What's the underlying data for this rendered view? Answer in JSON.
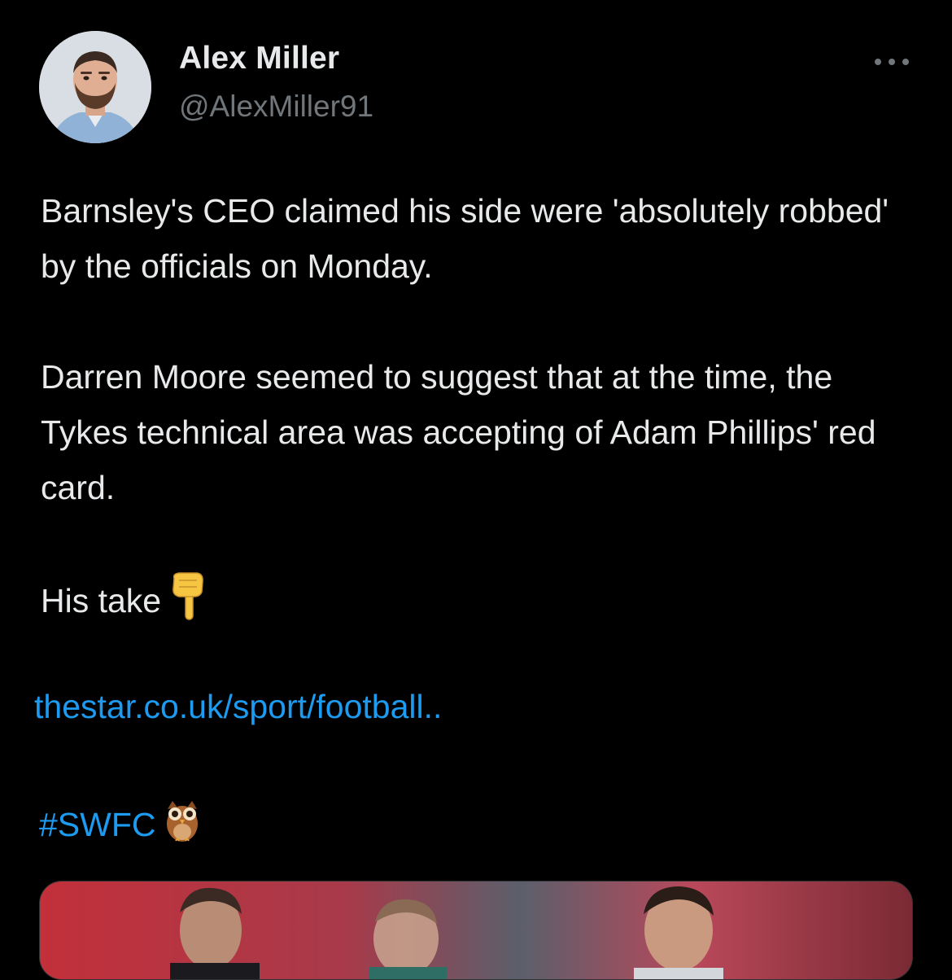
{
  "tweet": {
    "author": {
      "display_name": "Alex Miller",
      "handle": "@AlexMiller91",
      "avatar_icon": "profile-photo"
    },
    "more_icon": "more-horizontal-icon",
    "paragraphs": [
      "Barnsley's CEO claimed his side were 'absolutely robbed' by the officials on Monday.",
      "Darren Moore seemed to suggest that at the time, the Tykes technical area was accepting of Adam Phillips' red card."
    ],
    "take_text": "His take",
    "take_emoji": "pointing-down-emoji",
    "link_text": "thestar.co.uk/sport/football..",
    "hashtag": "#SWFC",
    "hashtag_emoji": "owl-emoji",
    "media": "football-players-photo"
  },
  "colors": {
    "background": "#000000",
    "primary_text": "#e7e9ea",
    "secondary_text": "#71767b",
    "link": "#1d9bf0"
  }
}
